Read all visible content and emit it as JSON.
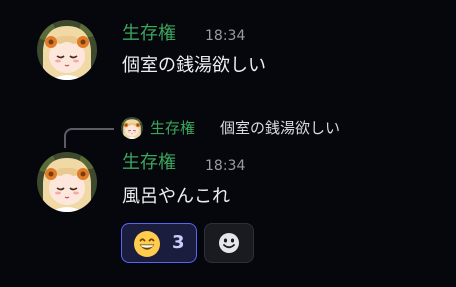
{
  "colors": {
    "username": "#3ba55c",
    "background": "#06070c",
    "reaction_accent": "#5865f2"
  },
  "messages": [
    {
      "username": "生存権",
      "timestamp": "18:34",
      "content": "個室の銭湯欲しい",
      "avatar_icon": "anime-girl-avatar-icon"
    },
    {
      "reply_to": {
        "username": "生存権",
        "content": "個室の銭湯欲しい"
      },
      "username": "生存権",
      "timestamp": "18:34",
      "content": "風呂やんこれ",
      "avatar_icon": "anime-girl-avatar-icon",
      "reactions": [
        {
          "emoji": "grinning-face",
          "count": "3",
          "reacted": true
        }
      ],
      "add_reaction_icon": "smiley-add-reaction-icon"
    }
  ]
}
